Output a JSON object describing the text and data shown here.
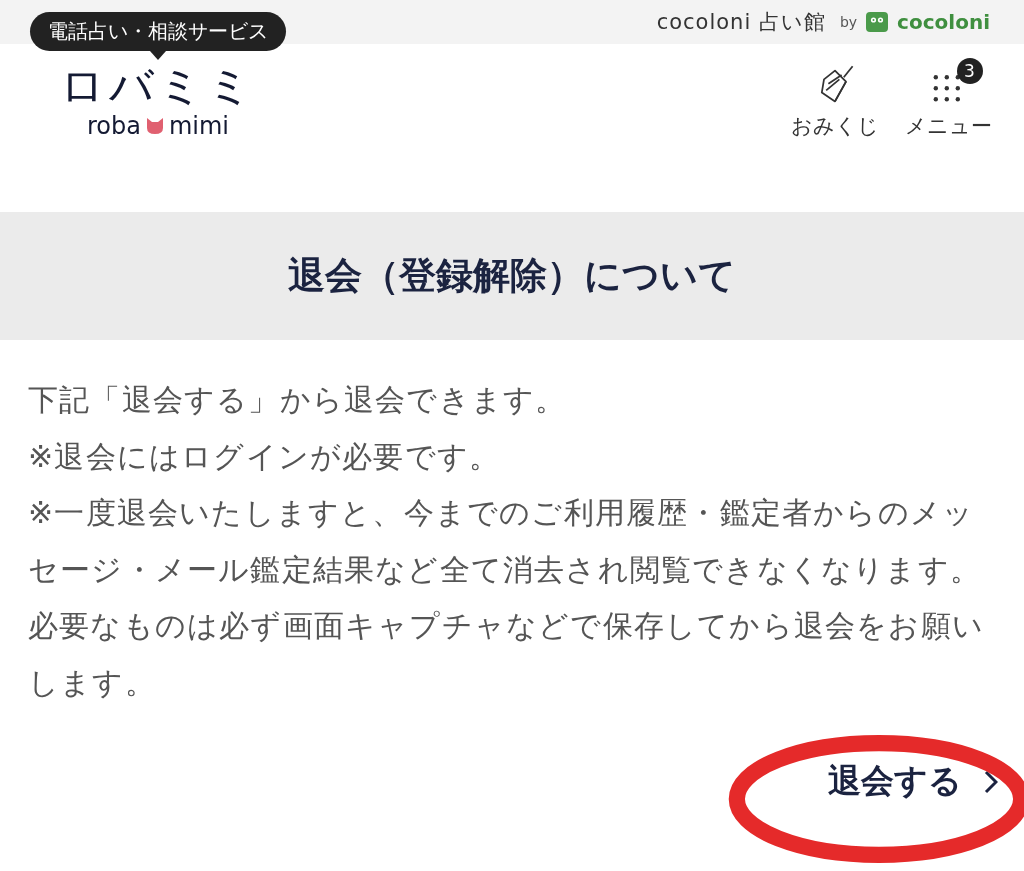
{
  "top_bar": {
    "brand": "cocoloni 占い館",
    "by": "by",
    "partner": "cocoloni"
  },
  "header": {
    "tagline": "電話占い・相談サービス",
    "logo": "ロバミミ",
    "logo_sub_left": "roba",
    "logo_sub_right": "mimi",
    "nav": [
      {
        "label": "おみくじ",
        "kind": "omikuji"
      },
      {
        "label": "メニュー",
        "kind": "menu",
        "badge": "3"
      }
    ]
  },
  "page_title": "退会（登録解除）について",
  "paragraphs": [
    "下記「退会する」から退会できます。",
    "※退会にはログインが必要です。",
    "※一度退会いたしますと、今までのご利用履歴・鑑定者からのメッセージ・メール鑑定結果など全て消去され閲覧できなくなります。必要なものは必ず画面キャプチャなどで保存してから退会をお願いします。"
  ],
  "action": {
    "label": "退会する"
  },
  "annotation": {
    "kind": "ellipse"
  }
}
